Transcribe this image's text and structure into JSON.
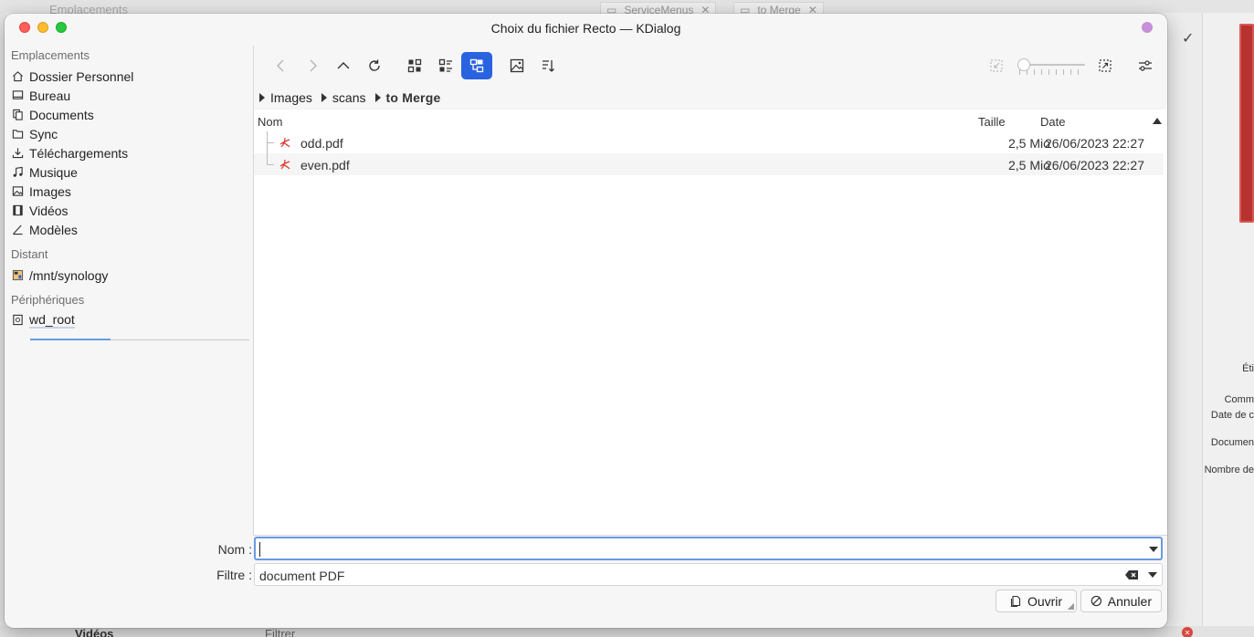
{
  "background": {
    "left_title": "Emplacements",
    "tabs": [
      "ServiceMenus",
      "to Merge"
    ],
    "right_labels": [
      "Éti",
      "Comm",
      "Date de c",
      "Documen",
      "Nombre de"
    ],
    "bottom_items": [
      "Vidéos",
      "Filtrer"
    ]
  },
  "dialog": {
    "title": "Choix du fichier Recto — KDialog"
  },
  "sidebar": {
    "sections": [
      {
        "title": "Emplacements",
        "items": [
          {
            "label": "Dossier Personnel",
            "icon": "home-icon"
          },
          {
            "label": "Bureau",
            "icon": "desktop-icon"
          },
          {
            "label": "Documents",
            "icon": "documents-icon"
          },
          {
            "label": "Sync",
            "icon": "folder-icon"
          },
          {
            "label": "Téléchargements",
            "icon": "download-icon"
          },
          {
            "label": "Musique",
            "icon": "music-icon"
          },
          {
            "label": "Images",
            "icon": "image-icon"
          },
          {
            "label": "Vidéos",
            "icon": "video-icon"
          },
          {
            "label": "Modèles",
            "icon": "template-icon"
          }
        ]
      },
      {
        "title": "Distant",
        "items": [
          {
            "label": "/mnt/synology",
            "icon": "network-drive-icon"
          }
        ]
      },
      {
        "title": "Périphériques",
        "items": [
          {
            "label": "wd_root",
            "icon": "disk-icon"
          }
        ]
      }
    ]
  },
  "breadcrumb": [
    "Images",
    "scans",
    "to Merge"
  ],
  "columns": {
    "name": "Nom",
    "size": "Taille",
    "date": "Date"
  },
  "files": [
    {
      "name": "odd.pdf",
      "size": "2,5 Mio",
      "date": "26/06/2023 22:27"
    },
    {
      "name": "even.pdf",
      "size": "2,5 Mio",
      "date": "26/06/2023 22:27"
    }
  ],
  "form": {
    "name_label": "Nom :",
    "name_value": "",
    "filter_label": "Filtre :",
    "filter_value": "document PDF"
  },
  "buttons": {
    "open": "Ouvrir",
    "cancel": "Annuler"
  },
  "colors": {
    "accent": "#2a63e0",
    "focus": "#6a9ae0",
    "pdf_icon": "#d8342c"
  }
}
